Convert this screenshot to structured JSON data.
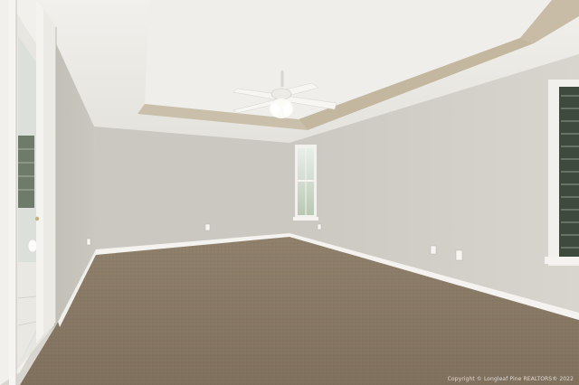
{
  "photo": {
    "subject": "empty-bedroom",
    "watermark": "Copyright © Longleaf Pine REALTORS® 2022",
    "colors": {
      "wall_left": "#c9c6be",
      "wall_back": "#cdcac3",
      "wall_right": "#d4d1ca",
      "ceiling": "#eceae6",
      "tray_trim": "#c6b9a2",
      "carpet": "#8a7a66",
      "baseboard": "#f4f3ef",
      "door_frame": "#f1f0ec"
    }
  }
}
